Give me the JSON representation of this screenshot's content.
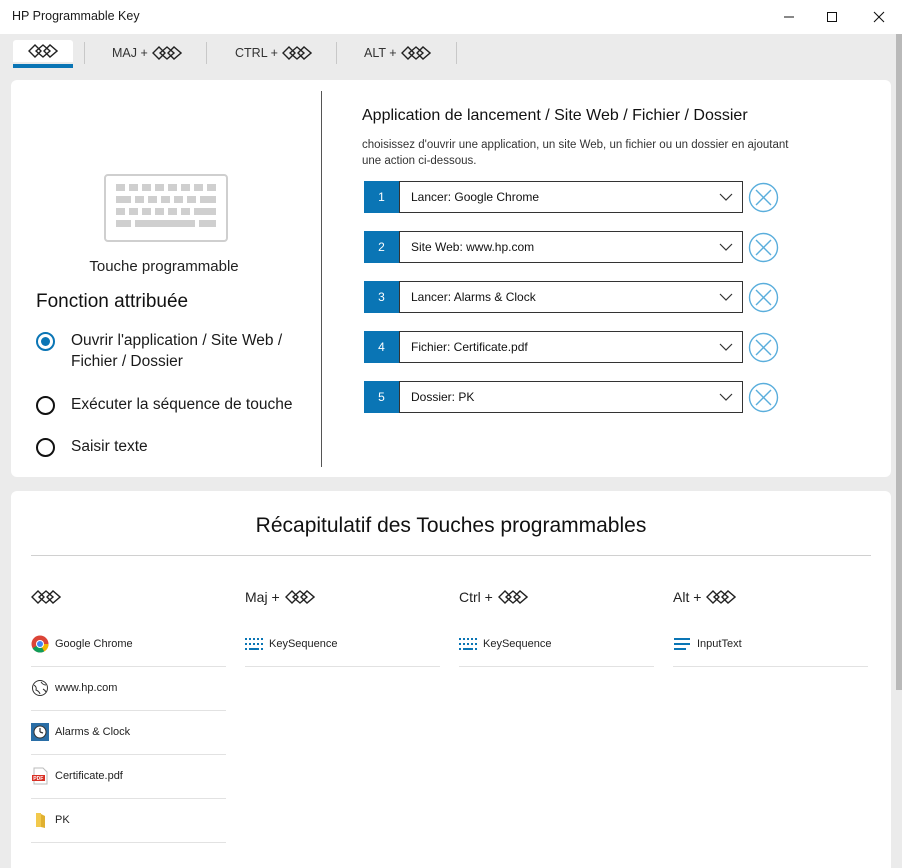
{
  "window": {
    "title": "HP Programmable Key"
  },
  "tabs": [
    {
      "prefix": ""
    },
    {
      "prefix": "MAJ +"
    },
    {
      "prefix": "CTRL +"
    },
    {
      "prefix": "ALT +"
    }
  ],
  "left": {
    "key_label": "Touche programmable",
    "function_title": "Fonction attribuée",
    "options": [
      {
        "line1": "Ouvrir l'application / Site Web /",
        "line2": "Fichier / Dossier",
        "checked": true
      },
      {
        "line1": "Exécuter la séquence de touche",
        "line2": "",
        "checked": false
      },
      {
        "line1": "Saisir texte",
        "line2": "",
        "checked": false
      }
    ]
  },
  "right": {
    "title": "Application de lancement / Site Web / Fichier / Dossier",
    "desc_line1": "choisissez d'ouvrir une application, un site Web, un fichier ou un dossier en ajoutant",
    "desc_line2": "une action ci-dessous.",
    "actions": [
      {
        "num": "1",
        "value": "Lancer: Google Chrome"
      },
      {
        "num": "2",
        "value": "Site Web: www.hp.com"
      },
      {
        "num": "3",
        "value": "Lancer: Alarms & Clock"
      },
      {
        "num": "4",
        "value": "Fichier: Certificate.pdf"
      },
      {
        "num": "5",
        "value": "Dossier: PK"
      }
    ]
  },
  "summary": {
    "title": "Récapitulatif des Touches programmables",
    "columns": [
      {
        "prefix": "",
        "items": [
          {
            "icon": "chrome-icon",
            "label": "Google Chrome"
          },
          {
            "icon": "globe-icon",
            "label": "www.hp.com"
          },
          {
            "icon": "clock-icon",
            "label": "Alarms & Clock"
          },
          {
            "icon": "pdf-icon",
            "label": "Certificate.pdf"
          },
          {
            "icon": "folder-icon",
            "label": "PK"
          }
        ]
      },
      {
        "prefix": "Maj +",
        "items": [
          {
            "icon": "keyboard-sequence-icon",
            "label": "KeySequence"
          }
        ]
      },
      {
        "prefix": "Ctrl +",
        "items": [
          {
            "icon": "keyboard-sequence-icon",
            "label": "KeySequence"
          }
        ]
      },
      {
        "prefix": "Alt +",
        "items": [
          {
            "icon": "text-lines-icon",
            "label": "InputText"
          }
        ]
      }
    ]
  },
  "colors": {
    "accent": "#0a75b5",
    "remove": "#5aaedc"
  }
}
